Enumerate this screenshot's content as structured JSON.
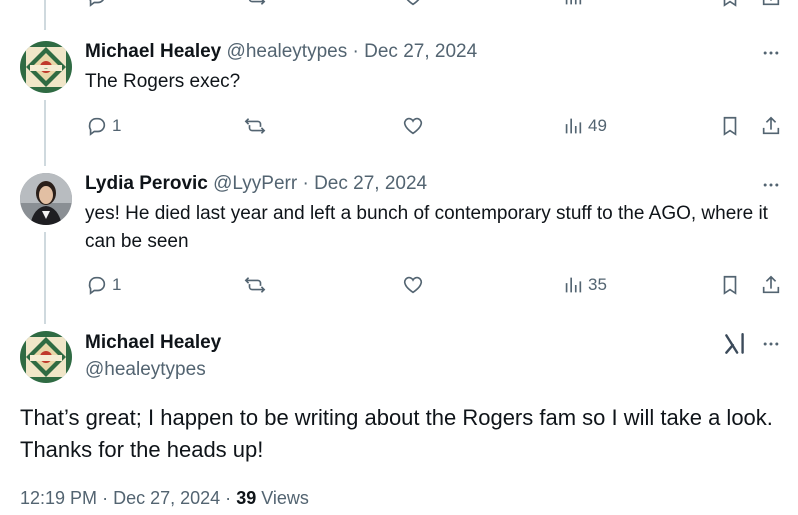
{
  "replies": [
    {
      "name": "Michael Healey",
      "handle": "@healeytypes",
      "date": "Dec 27, 2024",
      "text": "The Rogers exec?",
      "replies_count": "1",
      "views": "49"
    },
    {
      "name": "Lydia Perovic",
      "handle": "@LyyPerr",
      "date": "Dec 27, 2024",
      "text": "yes! He died last year and left a bunch of contemporary stuff to the AGO, where it can be seen",
      "replies_count": "1",
      "views": "35"
    }
  ],
  "main_tweet": {
    "name": "Michael Healey",
    "handle": "@healeytypes",
    "text": "That’s great; I happen to be writing about the Rogers fam so I will take a look. Thanks for the heads up!",
    "time": "12:19 PM",
    "date": "Dec 27, 2024",
    "views_count": "39",
    "views_label": "Views"
  },
  "separator": "·",
  "colors": {
    "text": "#0f1419",
    "muted": "#536471",
    "thread_line": "#cfd9de"
  },
  "icons": [
    "reply-icon",
    "retweet-icon",
    "like-icon",
    "views-icon",
    "bookmark-icon",
    "share-icon",
    "more-icon",
    "grok-icon",
    "avatar-pattern"
  ]
}
